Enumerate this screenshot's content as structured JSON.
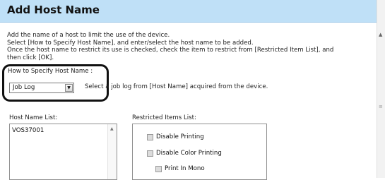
{
  "dialog": {
    "title": "Add Host Name",
    "description": [
      "Add the name of a host to limit the use of the device.",
      "Select [How to Specify Host Name], and enter/select the host name to be added.",
      "Once the host name to restrict its use is checked, check the item to restrict from [Restricted Item List], and",
      "then click [OK]."
    ]
  },
  "specify": {
    "label": "How to Specify Host Name :",
    "selected": "Job Log",
    "hint": "Select a job log from [Host Name] acquired from the device."
  },
  "host_list": {
    "label": "Host Name List:",
    "items": [
      "VOS37001"
    ]
  },
  "restricted_items": {
    "label": "Restricted Items List:",
    "items": [
      {
        "label": "Disable Printing",
        "checked": false
      },
      {
        "label": "Disable Color Printing",
        "checked": false
      },
      {
        "label": "Print In Mono",
        "checked": false
      }
    ]
  },
  "colors": {
    "header_bg": "#bfe0f7",
    "callout_border": "#111111"
  }
}
